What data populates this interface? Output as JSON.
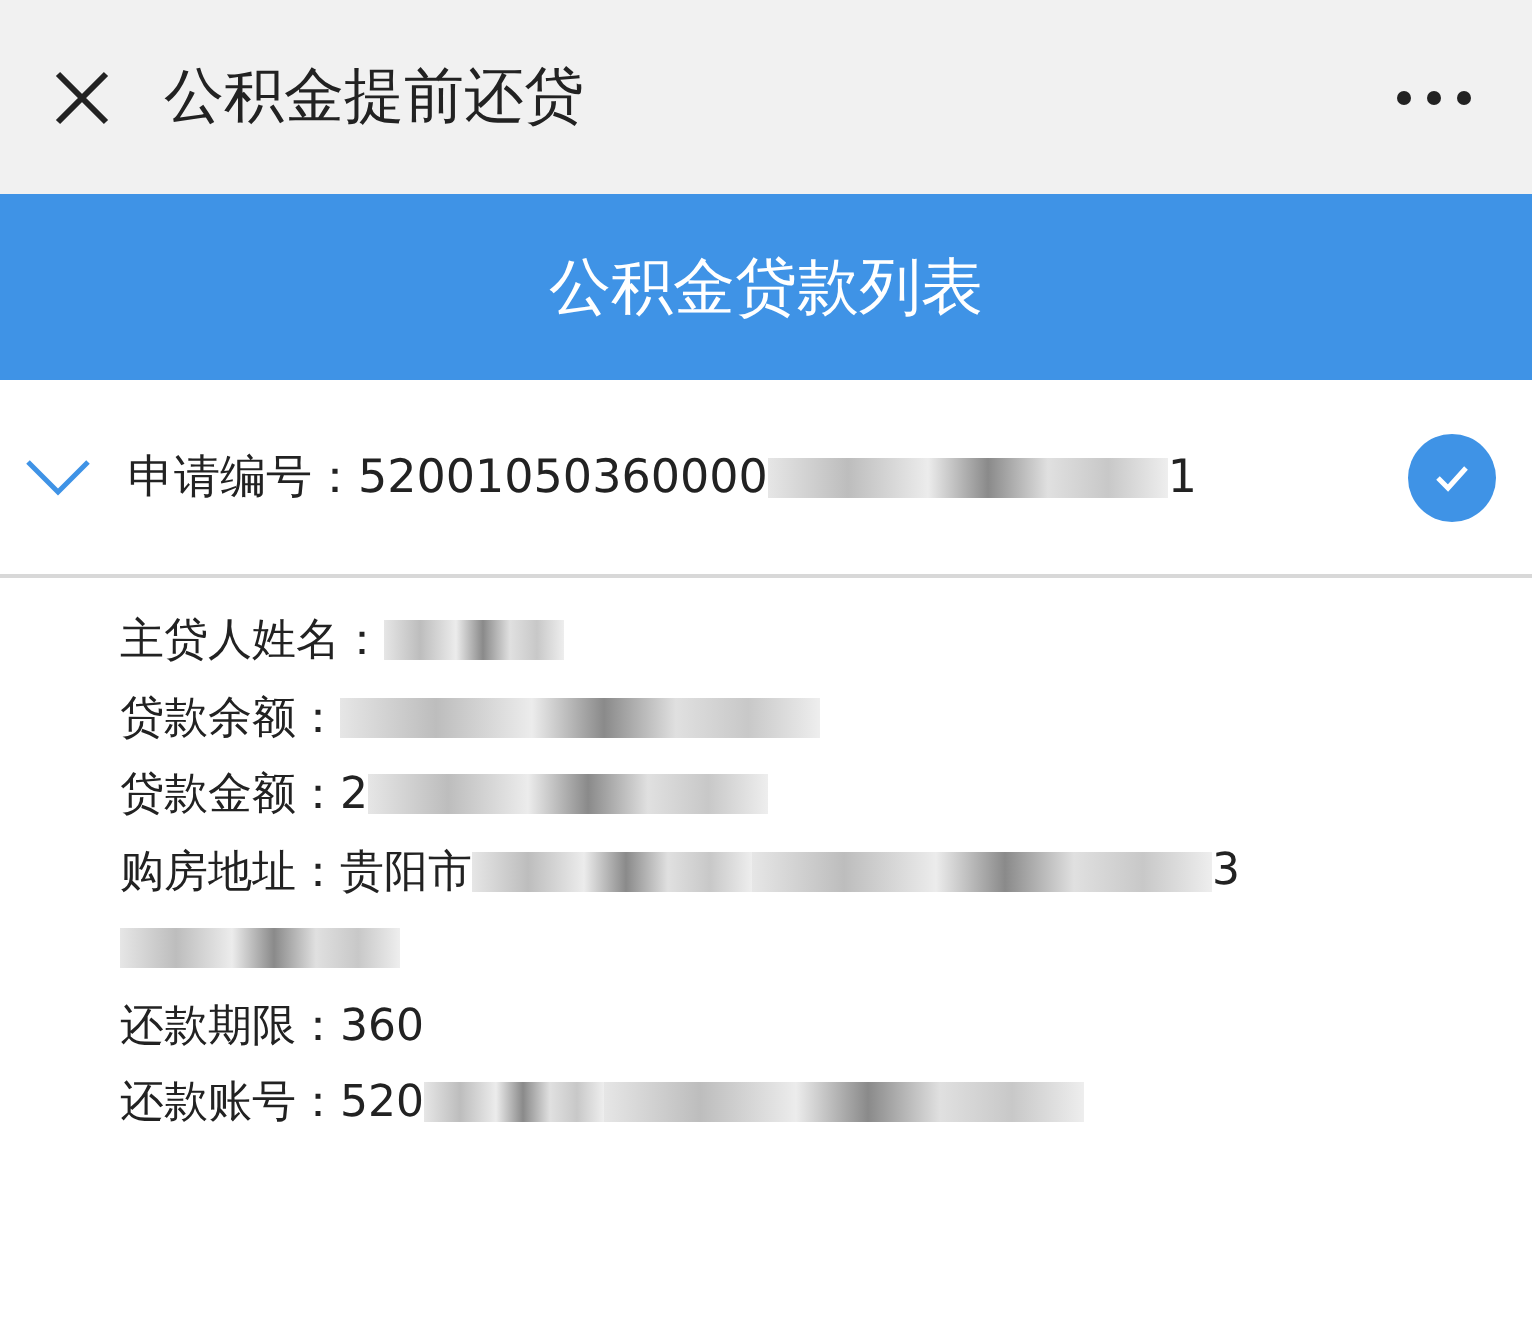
{
  "top_bar": {
    "title": "公积金提前还贷"
  },
  "banner": {
    "title": "公积金贷款列表"
  },
  "loan": {
    "expanded": true,
    "selected": true,
    "parts": [
      {
        "kind": "text",
        "text": "申请编号：52001050360000"
      },
      {
        "kind": "blur"
      },
      {
        "kind": "text",
        "text": "1"
      }
    ]
  },
  "details": [
    {
      "parts": [
        {
          "kind": "text",
          "text": "主贷人姓名："
        },
        {
          "kind": "blur"
        }
      ]
    },
    {
      "parts": [
        {
          "kind": "text",
          "text": "贷款余额："
        },
        {
          "kind": "blur"
        }
      ]
    },
    {
      "parts": [
        {
          "kind": "text",
          "text": "贷款金额：2"
        },
        {
          "kind": "blur"
        }
      ]
    },
    {
      "parts": [
        {
          "kind": "text",
          "text": "购房地址：贵阳市"
        },
        {
          "kind": "blur"
        },
        {
          "kind": "blur"
        },
        {
          "kind": "text",
          "text": "3"
        }
      ]
    },
    {
      "parts": [
        {
          "kind": "blur"
        }
      ]
    },
    {
      "parts": [
        {
          "kind": "text",
          "text": "还款期限：360"
        }
      ]
    },
    {
      "parts": [
        {
          "kind": "text",
          "text": "还款账号：520"
        },
        {
          "kind": "blur"
        },
        {
          "kind": "blur"
        }
      ]
    }
  ]
}
